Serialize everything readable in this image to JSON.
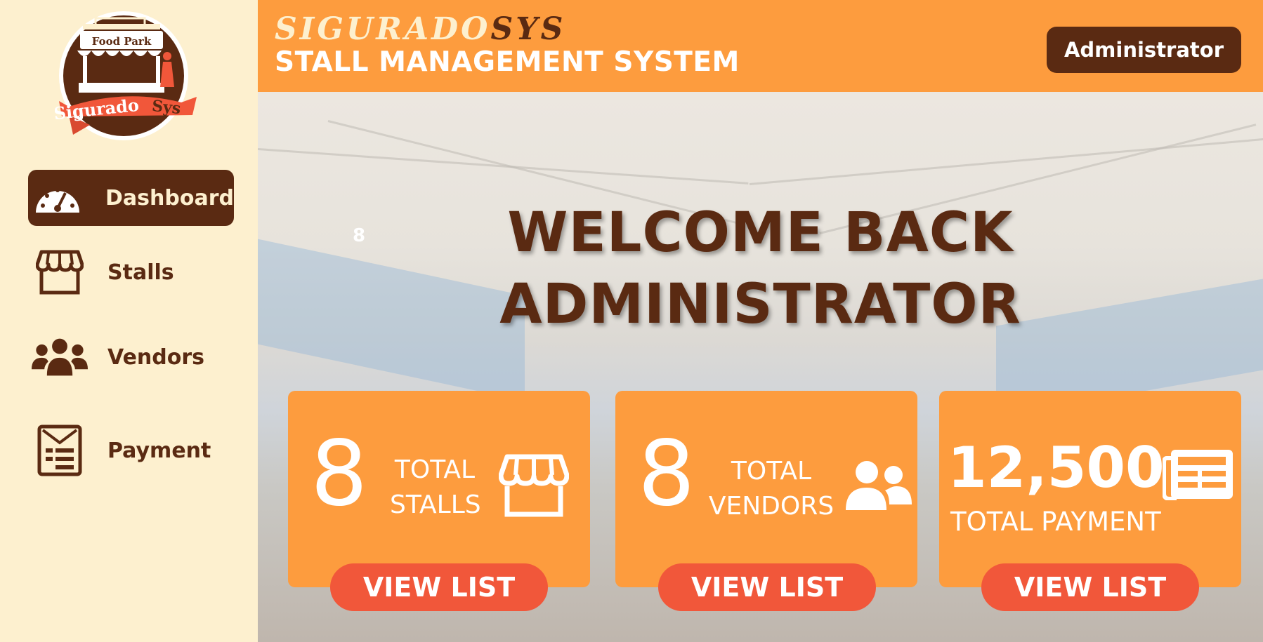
{
  "logo": {
    "top_text": "Food Park",
    "ribbon_text_a": "Sigurado",
    "ribbon_text_b": "Sys"
  },
  "sidebar": {
    "items": [
      {
        "label": "Dashboard",
        "icon": "dashboard-gauge-icon",
        "active": true
      },
      {
        "label": "Stalls",
        "icon": "storefront-icon",
        "active": false
      },
      {
        "label": "Vendors",
        "icon": "users-group-icon",
        "active": false
      },
      {
        "label": "Payment",
        "icon": "receipt-icon",
        "active": false
      }
    ]
  },
  "header": {
    "brand_a": "SIGURADO",
    "brand_b": "SYS",
    "subtitle": "STALL MANAGEMENT SYSTEM",
    "user_button": "Administrator"
  },
  "main": {
    "stray_value": "8",
    "welcome_line1": "WELCOME BACK",
    "welcome_line2": "ADMINISTRATOR",
    "cards": [
      {
        "value": "8",
        "label_line1": "TOTAL",
        "label_line2": "STALLS",
        "icon": "storefront-icon",
        "button": "VIEW LIST"
      },
      {
        "value": "8",
        "label_line1": "TOTAL",
        "label_line2": "VENDORS",
        "icon": "users-pair-icon",
        "button": "VIEW LIST"
      },
      {
        "value": "12,500",
        "label_line1": "TOTAL PAYMENT",
        "icon": "newspaper-icon",
        "button": "VIEW LIST"
      }
    ]
  },
  "colors": {
    "sidebar_bg": "#fdf0cf",
    "brown": "#5a2a12",
    "orange": "#fd9c3e",
    "button_red": "#f1573a"
  }
}
